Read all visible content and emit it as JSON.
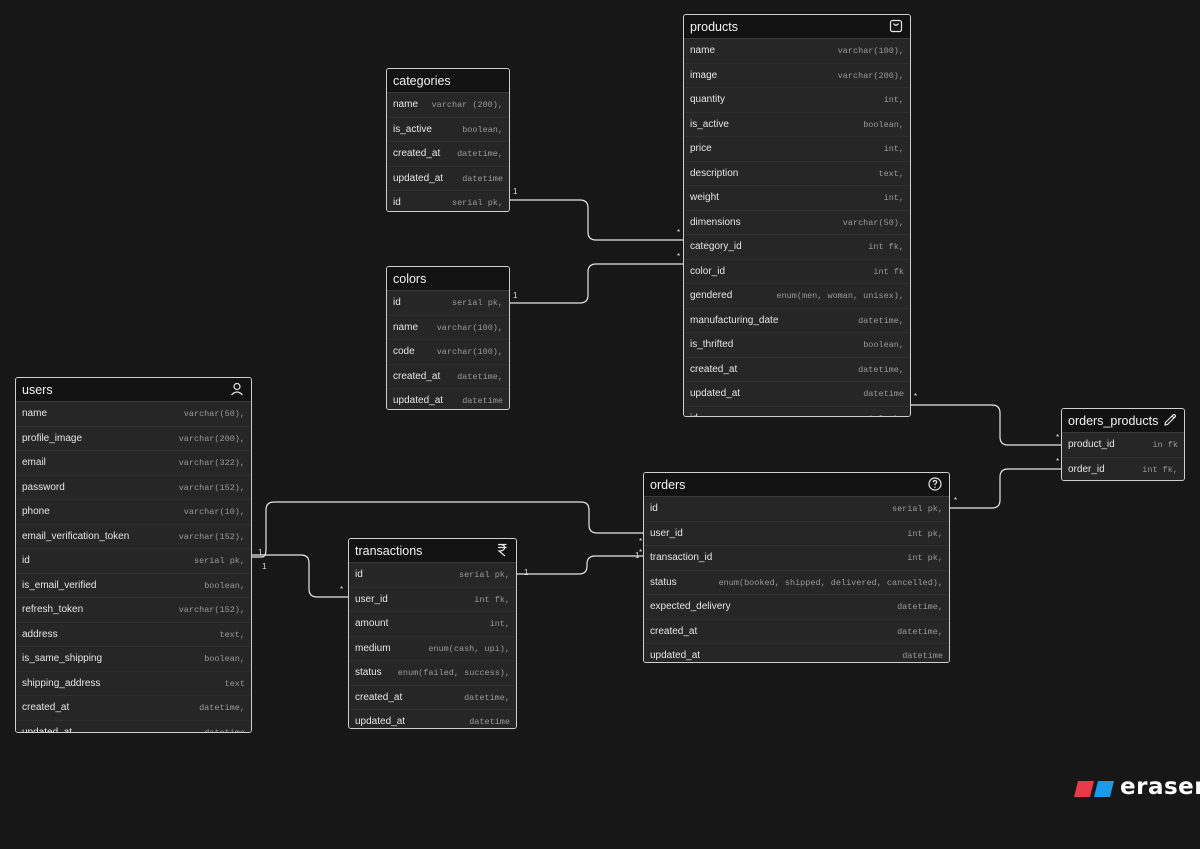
{
  "tables": {
    "categories": {
      "title": "categories",
      "icon": null,
      "fields": [
        {
          "name": "name",
          "type": "varchar (200),"
        },
        {
          "name": "is_active",
          "type": "boolean,"
        },
        {
          "name": "created_at",
          "type": "datetime,"
        },
        {
          "name": "updated_at",
          "type": "datetime"
        },
        {
          "name": "id",
          "type": "serial pk,"
        }
      ]
    },
    "colors": {
      "title": "colors",
      "icon": null,
      "fields": [
        {
          "name": "id",
          "type": "serial pk,"
        },
        {
          "name": "name",
          "type": "varchar(100),"
        },
        {
          "name": "code",
          "type": "varchar(100),"
        },
        {
          "name": "created_at",
          "type": "datetime,"
        },
        {
          "name": "updated_at",
          "type": "datetime"
        }
      ]
    },
    "products": {
      "title": "products",
      "icon": "shopping-bag-icon",
      "fields": [
        {
          "name": "name",
          "type": "varchar(100),"
        },
        {
          "name": "image",
          "type": "varchar(200),"
        },
        {
          "name": "quantity",
          "type": "int,"
        },
        {
          "name": "is_active",
          "type": "boolean,"
        },
        {
          "name": "price",
          "type": "int,"
        },
        {
          "name": "description",
          "type": "text,"
        },
        {
          "name": "weight",
          "type": "int,"
        },
        {
          "name": "dimensions",
          "type": "varchar(50),"
        },
        {
          "name": "category_id",
          "type": "int fk,"
        },
        {
          "name": "color_id",
          "type": "int fk"
        },
        {
          "name": "gendered",
          "type": "enum(men, woman, unisex),"
        },
        {
          "name": "manufacturing_date",
          "type": "datetime,"
        },
        {
          "name": "is_thrifted",
          "type": "boolean,"
        },
        {
          "name": "created_at",
          "type": "datetime,"
        },
        {
          "name": "updated_at",
          "type": "datetime"
        },
        {
          "name": "id",
          "type": "serial pk,"
        }
      ]
    },
    "users": {
      "title": "users",
      "icon": "user-icon",
      "fields": [
        {
          "name": "name",
          "type": "varchar(50),"
        },
        {
          "name": "profile_image",
          "type": "varchar(200),"
        },
        {
          "name": "email",
          "type": "varchar(322),"
        },
        {
          "name": "password",
          "type": "varchar(152),"
        },
        {
          "name": "phone",
          "type": "varchar(10),"
        },
        {
          "name": "email_verification_token",
          "type": "varchar(152),"
        },
        {
          "name": "id",
          "type": "serial pk,"
        },
        {
          "name": "is_email_verified",
          "type": "boolean,"
        },
        {
          "name": "refresh_token",
          "type": "varchar(152),"
        },
        {
          "name": "address",
          "type": "text,"
        },
        {
          "name": "is_same_shipping",
          "type": "boolean,"
        },
        {
          "name": "shipping_address",
          "type": "text"
        },
        {
          "name": "created_at",
          "type": "datetime,"
        },
        {
          "name": "updated_at",
          "type": "datetime"
        }
      ]
    },
    "transactions": {
      "title": "transactions",
      "icon": "rupee-icon",
      "fields": [
        {
          "name": "id",
          "type": "serial pk,"
        },
        {
          "name": "user_id",
          "type": "int fk,"
        },
        {
          "name": "amount",
          "type": "int,"
        },
        {
          "name": "medium",
          "type": "enum(cash, upi),"
        },
        {
          "name": "status",
          "type": "enum(failed, success),"
        },
        {
          "name": "created_at",
          "type": "datetime,"
        },
        {
          "name": "updated_at",
          "type": "datetime"
        }
      ]
    },
    "orders": {
      "title": "orders",
      "icon": "question-circle-icon",
      "fields": [
        {
          "name": "id",
          "type": "serial pk,"
        },
        {
          "name": "user_id",
          "type": "int pk,"
        },
        {
          "name": "transaction_id",
          "type": "int pk,"
        },
        {
          "name": "status",
          "type": "enum(booked, shipped, delivered, cancelled),"
        },
        {
          "name": "expected_delivery",
          "type": "datetime,"
        },
        {
          "name": "created_at",
          "type": "datetime,"
        },
        {
          "name": "updated_at",
          "type": "datetime"
        }
      ]
    },
    "orders_products": {
      "title": "orders_products",
      "icon": "pencil-icon",
      "fields": [
        {
          "name": "product_id",
          "type": "in fk"
        },
        {
          "name": "order_id",
          "type": "int fk,"
        }
      ]
    }
  },
  "cardinality": {
    "one": "1",
    "many": "*"
  },
  "brand": {
    "name": "eraser",
    "color_red": "#e83a4a",
    "color_blue": "#1a9ae8"
  }
}
